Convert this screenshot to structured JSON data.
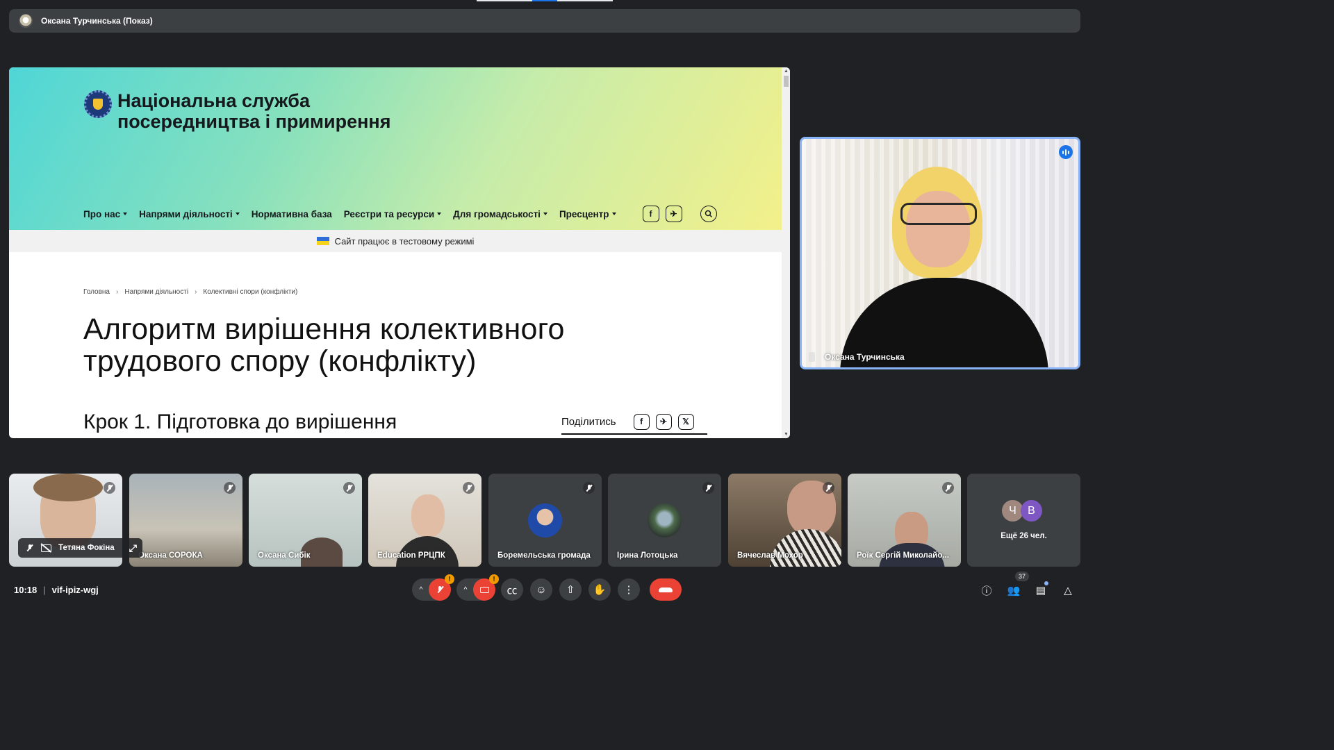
{
  "presenter_bar": {
    "name": "Оксана Турчинська (Показ)"
  },
  "shared_screen": {
    "site_title": "Національна служба\nпосередництва і примирення",
    "nav": [
      {
        "label": "Про нас",
        "dropdown": true
      },
      {
        "label": "Напрями діяльності",
        "dropdown": true
      },
      {
        "label": "Нормативна база",
        "dropdown": false
      },
      {
        "label": "Реєстри та ресурси",
        "dropdown": true
      },
      {
        "label": "Для громадськості",
        "dropdown": true
      },
      {
        "label": "Пресцентр",
        "dropdown": true
      }
    ],
    "social_icons": [
      "facebook-icon",
      "telegram-icon"
    ],
    "notice": "Сайт працює в тестовому режимі",
    "breadcrumbs": [
      "Головна",
      "Напрями діяльності",
      "Колективні спори (конфлікти)"
    ],
    "heading": "Алгоритм вирішення колективного\nтрудового спору (конфлікту)",
    "subheading": "Крок 1. Підготовка до вирішення",
    "share_label": "Поділитись",
    "share_icons": {
      "facebook": "f",
      "telegram": "✈",
      "x": "𝕏"
    }
  },
  "speaker": {
    "name": "Оксана Турчинська"
  },
  "participants": [
    {
      "name": "Оксана СОРОКА",
      "bg": "#b9b4a8"
    },
    {
      "name": "Оксана Сибік",
      "bg": "#c9d4d2"
    },
    {
      "name": "Education РРЦПК",
      "bg": "#d8d2c8"
    },
    {
      "name": "Боремельська громада",
      "bg": "#3c4043"
    },
    {
      "name": "Ірина Лотоцька",
      "bg": "#3c4043"
    },
    {
      "name": "Вячеслав Мохор",
      "bg": "#6b5a48"
    },
    {
      "name": "Роїк Сергій Миколайо...",
      "bg": "#b8bab6"
    }
  ],
  "self_view": {
    "name": "Тетяна Фокіна",
    "expand_icon": "⤢"
  },
  "more": {
    "chips": [
      "Ч",
      "В"
    ],
    "chip_colors": [
      "#a1887f",
      "#7e57c2"
    ],
    "label": "Ещё 26 чел."
  },
  "meeting": {
    "time": "10:18",
    "code": "vif-ipiz-wgj"
  },
  "controls": {
    "warn": "!",
    "captions": "㏄",
    "emoji": "☺",
    "present": "⇧",
    "hand": "✋",
    "more": "⋮",
    "chevron": "^"
  },
  "right_controls": {
    "info": "ⓘ",
    "people_count": "37",
    "people": "👥",
    "chat": "▤",
    "activities": "△"
  }
}
